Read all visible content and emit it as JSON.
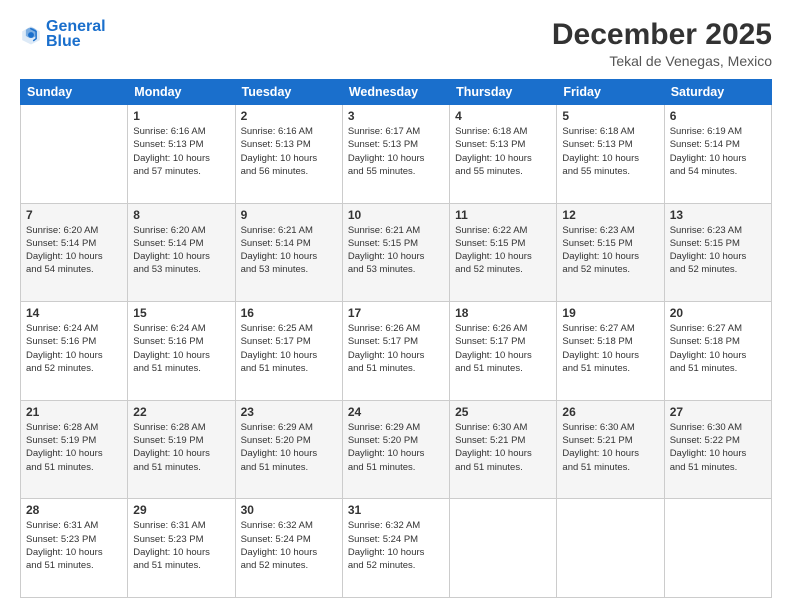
{
  "header": {
    "logo_line1": "General",
    "logo_line2": "Blue",
    "title": "December 2025",
    "subtitle": "Tekal de Venegas, Mexico"
  },
  "columns": [
    "Sunday",
    "Monday",
    "Tuesday",
    "Wednesday",
    "Thursday",
    "Friday",
    "Saturday"
  ],
  "weeks": [
    [
      {
        "day": "",
        "info": ""
      },
      {
        "day": "1",
        "info": "Sunrise: 6:16 AM\nSunset: 5:13 PM\nDaylight: 10 hours\nand 57 minutes."
      },
      {
        "day": "2",
        "info": "Sunrise: 6:16 AM\nSunset: 5:13 PM\nDaylight: 10 hours\nand 56 minutes."
      },
      {
        "day": "3",
        "info": "Sunrise: 6:17 AM\nSunset: 5:13 PM\nDaylight: 10 hours\nand 55 minutes."
      },
      {
        "day": "4",
        "info": "Sunrise: 6:18 AM\nSunset: 5:13 PM\nDaylight: 10 hours\nand 55 minutes."
      },
      {
        "day": "5",
        "info": "Sunrise: 6:18 AM\nSunset: 5:13 PM\nDaylight: 10 hours\nand 55 minutes."
      },
      {
        "day": "6",
        "info": "Sunrise: 6:19 AM\nSunset: 5:14 PM\nDaylight: 10 hours\nand 54 minutes."
      }
    ],
    [
      {
        "day": "7",
        "info": "Sunrise: 6:20 AM\nSunset: 5:14 PM\nDaylight: 10 hours\nand 54 minutes."
      },
      {
        "day": "8",
        "info": "Sunrise: 6:20 AM\nSunset: 5:14 PM\nDaylight: 10 hours\nand 53 minutes."
      },
      {
        "day": "9",
        "info": "Sunrise: 6:21 AM\nSunset: 5:14 PM\nDaylight: 10 hours\nand 53 minutes."
      },
      {
        "day": "10",
        "info": "Sunrise: 6:21 AM\nSunset: 5:15 PM\nDaylight: 10 hours\nand 53 minutes."
      },
      {
        "day": "11",
        "info": "Sunrise: 6:22 AM\nSunset: 5:15 PM\nDaylight: 10 hours\nand 52 minutes."
      },
      {
        "day": "12",
        "info": "Sunrise: 6:23 AM\nSunset: 5:15 PM\nDaylight: 10 hours\nand 52 minutes."
      },
      {
        "day": "13",
        "info": "Sunrise: 6:23 AM\nSunset: 5:15 PM\nDaylight: 10 hours\nand 52 minutes."
      }
    ],
    [
      {
        "day": "14",
        "info": "Sunrise: 6:24 AM\nSunset: 5:16 PM\nDaylight: 10 hours\nand 52 minutes."
      },
      {
        "day": "15",
        "info": "Sunrise: 6:24 AM\nSunset: 5:16 PM\nDaylight: 10 hours\nand 51 minutes."
      },
      {
        "day": "16",
        "info": "Sunrise: 6:25 AM\nSunset: 5:17 PM\nDaylight: 10 hours\nand 51 minutes."
      },
      {
        "day": "17",
        "info": "Sunrise: 6:26 AM\nSunset: 5:17 PM\nDaylight: 10 hours\nand 51 minutes."
      },
      {
        "day": "18",
        "info": "Sunrise: 6:26 AM\nSunset: 5:17 PM\nDaylight: 10 hours\nand 51 minutes."
      },
      {
        "day": "19",
        "info": "Sunrise: 6:27 AM\nSunset: 5:18 PM\nDaylight: 10 hours\nand 51 minutes."
      },
      {
        "day": "20",
        "info": "Sunrise: 6:27 AM\nSunset: 5:18 PM\nDaylight: 10 hours\nand 51 minutes."
      }
    ],
    [
      {
        "day": "21",
        "info": "Sunrise: 6:28 AM\nSunset: 5:19 PM\nDaylight: 10 hours\nand 51 minutes."
      },
      {
        "day": "22",
        "info": "Sunrise: 6:28 AM\nSunset: 5:19 PM\nDaylight: 10 hours\nand 51 minutes."
      },
      {
        "day": "23",
        "info": "Sunrise: 6:29 AM\nSunset: 5:20 PM\nDaylight: 10 hours\nand 51 minutes."
      },
      {
        "day": "24",
        "info": "Sunrise: 6:29 AM\nSunset: 5:20 PM\nDaylight: 10 hours\nand 51 minutes."
      },
      {
        "day": "25",
        "info": "Sunrise: 6:30 AM\nSunset: 5:21 PM\nDaylight: 10 hours\nand 51 minutes."
      },
      {
        "day": "26",
        "info": "Sunrise: 6:30 AM\nSunset: 5:21 PM\nDaylight: 10 hours\nand 51 minutes."
      },
      {
        "day": "27",
        "info": "Sunrise: 6:30 AM\nSunset: 5:22 PM\nDaylight: 10 hours\nand 51 minutes."
      }
    ],
    [
      {
        "day": "28",
        "info": "Sunrise: 6:31 AM\nSunset: 5:23 PM\nDaylight: 10 hours\nand 51 minutes."
      },
      {
        "day": "29",
        "info": "Sunrise: 6:31 AM\nSunset: 5:23 PM\nDaylight: 10 hours\nand 51 minutes."
      },
      {
        "day": "30",
        "info": "Sunrise: 6:32 AM\nSunset: 5:24 PM\nDaylight: 10 hours\nand 52 minutes."
      },
      {
        "day": "31",
        "info": "Sunrise: 6:32 AM\nSunset: 5:24 PM\nDaylight: 10 hours\nand 52 minutes."
      },
      {
        "day": "",
        "info": ""
      },
      {
        "day": "",
        "info": ""
      },
      {
        "day": "",
        "info": ""
      }
    ]
  ]
}
